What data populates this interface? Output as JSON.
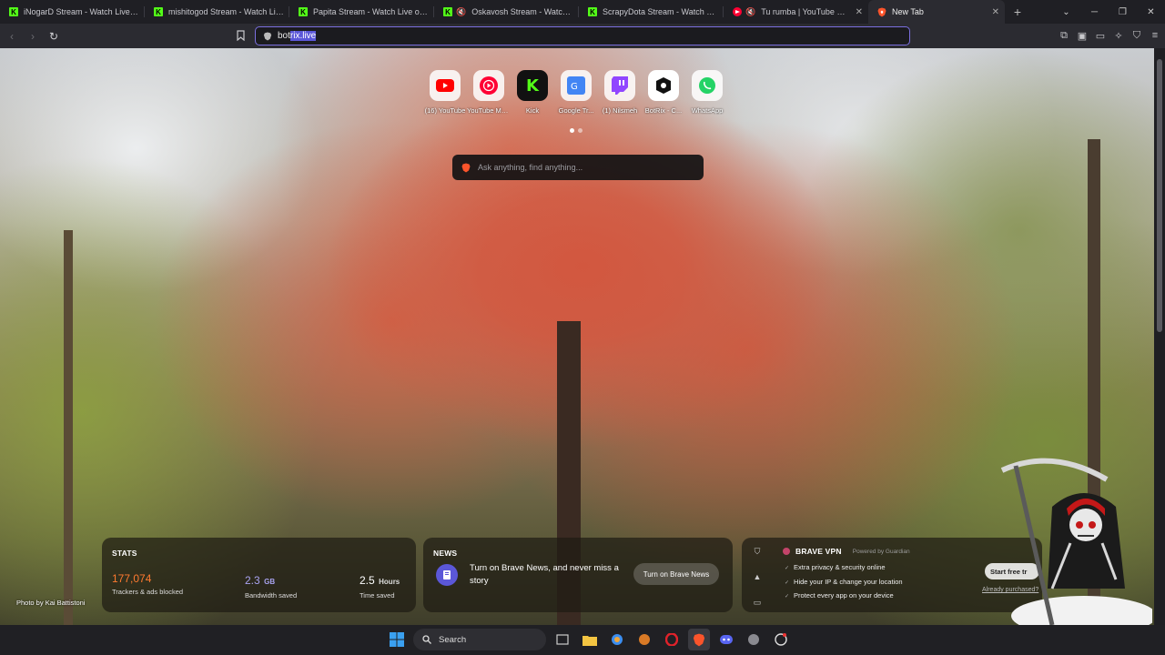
{
  "tabs": [
    {
      "title": "iNogarD Stream - Watch Live on K",
      "favicon": "kick-icon"
    },
    {
      "title": "mishitogod Stream - Watch Live on",
      "favicon": "kick-icon"
    },
    {
      "title": "Papita Stream - Watch Live on Kick",
      "favicon": "kick-icon"
    },
    {
      "title": "Oskavosh Stream - Watch Live on K",
      "favicon": "kick-icon"
    },
    {
      "title": "ScrapyDota Stream - Watch Live on",
      "favicon": "kick-icon"
    },
    {
      "title": "Tu rumba | YouTube Music",
      "favicon": "youtube-music-icon"
    },
    {
      "title": "New Tab",
      "favicon": "brave-icon",
      "active": true
    }
  ],
  "toolbar": {
    "url_text_plain": "bot",
    "url_text_selected": "rix.live"
  },
  "topsites": [
    {
      "label": "(16) YouTube",
      "icon": "youtube-icon",
      "color": "#ff0000"
    },
    {
      "label": "YouTube Music",
      "icon": "youtube-music-icon",
      "color": "#ff0033"
    },
    {
      "label": "Kick",
      "icon": "kick-icon",
      "color": "#53fc18"
    },
    {
      "label": "Google Tr...",
      "icon": "google-translate-icon",
      "color": "#4285f4"
    },
    {
      "label": "(1) Nilsmeh",
      "icon": "twitch-icon",
      "color": "#9146ff"
    },
    {
      "label": "BotRix - C...",
      "icon": "botrix-icon",
      "color": "#111111"
    },
    {
      "label": "WhatsApp",
      "icon": "whatsapp-icon",
      "color": "#25d366"
    }
  ],
  "search": {
    "placeholder": "Ask anything, find anything..."
  },
  "photo_credit": "Photo by Kai Battistoni",
  "stats": {
    "title": "STATS",
    "trackers_value": "177,074",
    "trackers_label": "Trackers & ads blocked",
    "bandwidth_value": "2.3",
    "bandwidth_unit": "GB",
    "bandwidth_label": "Bandwidth saved",
    "time_value": "2.5",
    "time_unit": "Hours",
    "time_label": "Time saved",
    "accent": "#ff7a2f"
  },
  "news": {
    "title": "NEWS",
    "text": "Turn on Brave News, and never miss a story",
    "button": "Turn on Brave News"
  },
  "vpn": {
    "title": "BRAVE VPN",
    "powered": "Powered by Guardian",
    "features": [
      "Extra privacy & security online",
      "Hide your IP & change your location",
      "Protect every app on your device"
    ],
    "trial_button": "Start free tr",
    "link": "Already purchased?"
  },
  "taskbar": {
    "search_label": "Search"
  }
}
